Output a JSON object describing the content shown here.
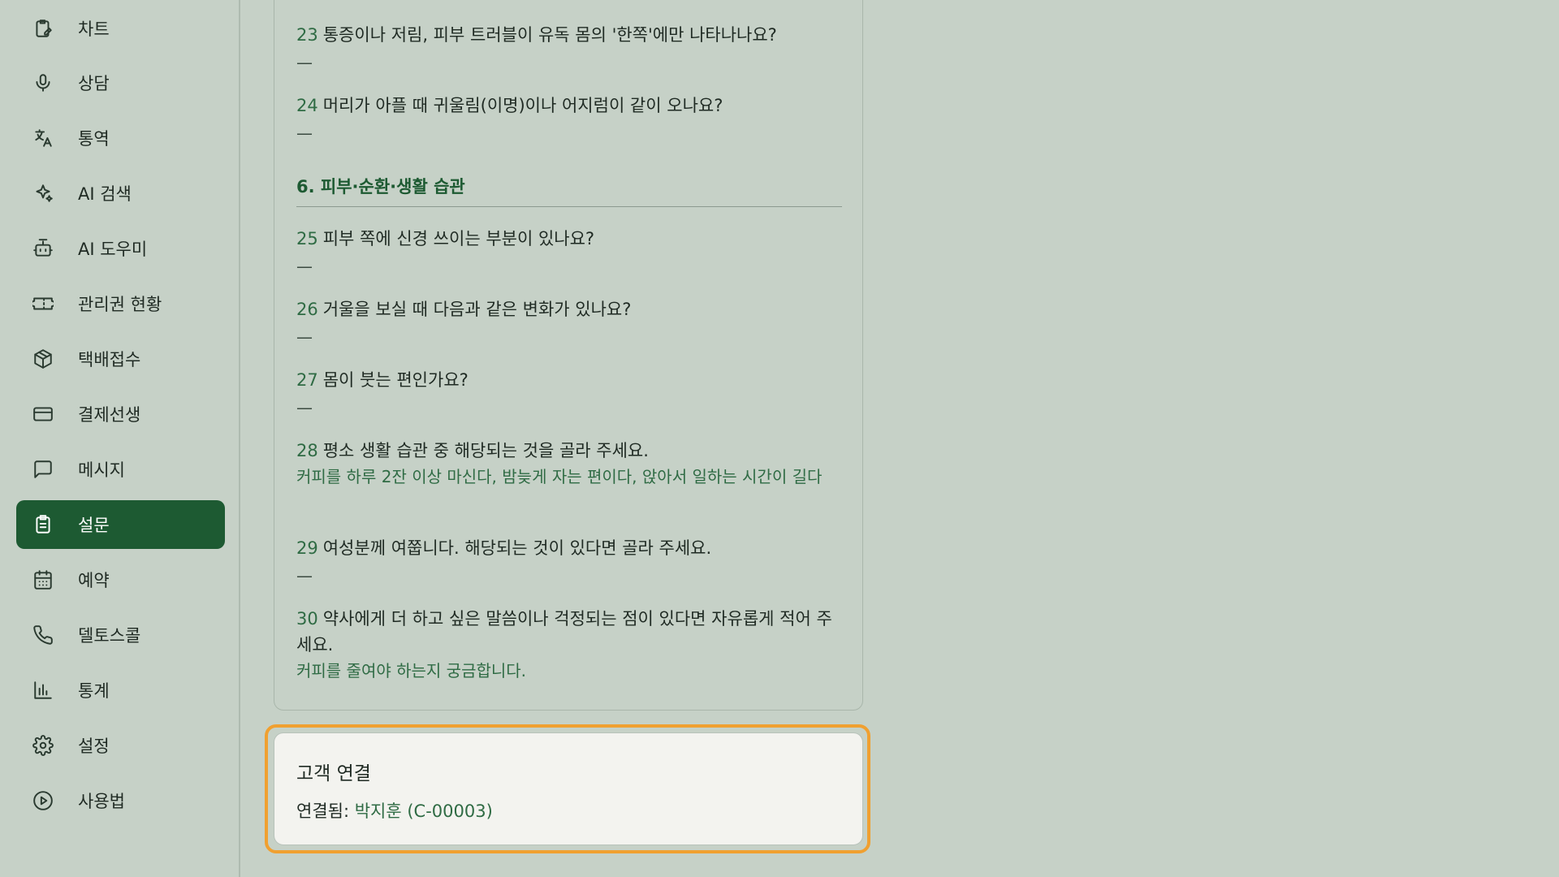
{
  "sidebar": {
    "items": [
      {
        "label": "차트",
        "icon": "clipboard-pen-icon",
        "active": false
      },
      {
        "label": "상담",
        "icon": "microphone-icon",
        "active": false
      },
      {
        "label": "통역",
        "icon": "translate-icon",
        "active": false
      },
      {
        "label": "AI 검색",
        "icon": "sparkles-icon",
        "active": false
      },
      {
        "label": "AI 도우미",
        "icon": "bot-icon",
        "active": false
      },
      {
        "label": "관리권 현황",
        "icon": "ticket-icon",
        "active": false
      },
      {
        "label": "택배접수",
        "icon": "package-icon",
        "active": false
      },
      {
        "label": "결제선생",
        "icon": "credit-card-icon",
        "active": false
      },
      {
        "label": "메시지",
        "icon": "message-square-icon",
        "active": false
      },
      {
        "label": "설문",
        "icon": "clipboard-list-icon",
        "active": true
      },
      {
        "label": "예약",
        "icon": "calendar-icon",
        "active": false
      },
      {
        "label": "델토스콜",
        "icon": "phone-icon",
        "active": false
      },
      {
        "label": "통계",
        "icon": "bar-chart-icon",
        "active": false
      },
      {
        "label": "설정",
        "icon": "gear-icon",
        "active": false
      },
      {
        "label": "사용법",
        "icon": "play-circle-icon",
        "active": false
      }
    ]
  },
  "survey": {
    "questions": [
      {
        "num": "23",
        "text": "통증이나 저림, 피부 트러블이 유독 몸의 '한쪽'에만 나타나나요?",
        "answer": "—"
      },
      {
        "num": "24",
        "text": "머리가 아플 때 귀울림(이명)이나 어지럼이 같이 오나요?",
        "answer": "—"
      },
      {
        "num": "25",
        "text": "피부 쪽에 신경 쓰이는 부분이 있나요?",
        "answer": "—"
      },
      {
        "num": "26",
        "text": "거울을 보실 때 다음과 같은 변화가 있나요?",
        "answer": "—"
      },
      {
        "num": "27",
        "text": "몸이 붓는 편인가요?",
        "answer": "—"
      },
      {
        "num": "28",
        "text": "평소 생활 습관 중 해당되는 것을 골라 주세요.",
        "answer": "커피를 하루 2잔 이상 마신다, 밤늦게 자는 편이다, 앉아서 일하는 시간이 길다"
      },
      {
        "num": "29",
        "text": "여성분께 여쭙니다. 해당되는 것이 있다면 골라 주세요.",
        "answer": "—"
      },
      {
        "num": "30",
        "text": "약사에게 더 하고 싶은 말씀이나 걱정되는 점이 있다면 자유롭게 적어 주세요.",
        "answer": "커피를 줄여야 하는지 궁금합니다."
      }
    ],
    "section6_title": "6. 피부·순환·생활 습관"
  },
  "customer_link": {
    "title": "고객 연결",
    "status_label": "연결됨:",
    "status_value": "박지훈 (C-00003)"
  },
  "colors": {
    "active_nav": "#1d5a32",
    "highlight": "#f0a030",
    "answer_text": "#2f6b44"
  }
}
